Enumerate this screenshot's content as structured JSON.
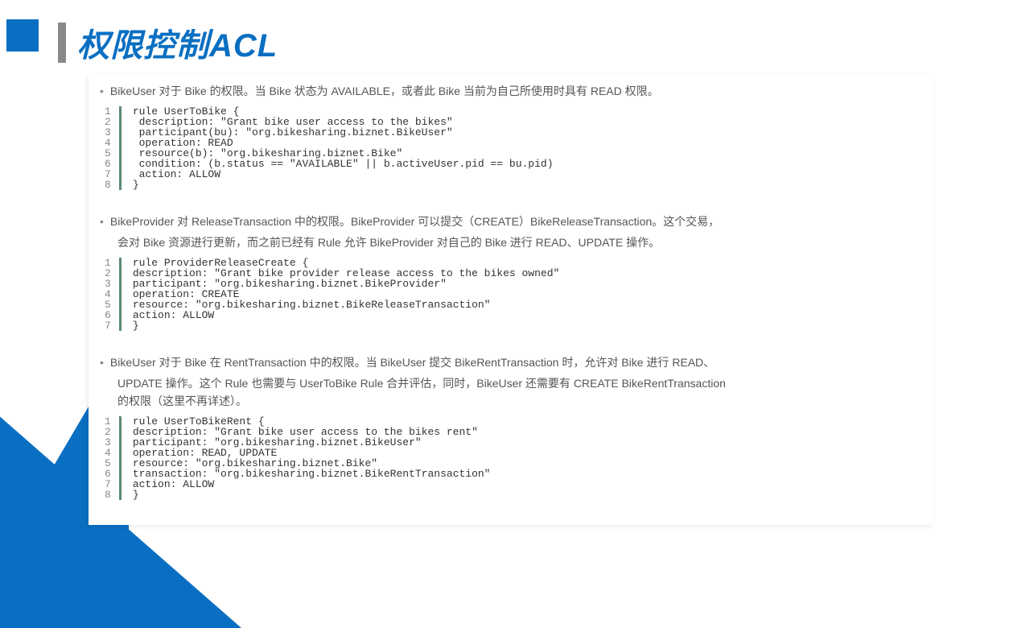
{
  "title": "权限控制ACL",
  "sections": [
    {
      "bullet": "BikeUser 对于 Bike 的权限。当 Bike 状态为 AVAILABLE，或者此 Bike 当前为自己所使用时具有 READ 权限。",
      "code": [
        "rule UserToBike {",
        " description: \"Grant bike user access to the bikes\"",
        " participant(bu): \"org.bikesharing.biznet.BikeUser\"",
        " operation: READ",
        " resource(b): \"org.bikesharing.biznet.Bike\"",
        " condition: (b.status == \"AVAILABLE\" || b.activeUser.pid == bu.pid)",
        " action: ALLOW",
        "}"
      ]
    },
    {
      "bullet": "BikeProvider 对 ReleaseTransaction 中的权限。BikeProvider 可以提交（CREATE）BikeReleaseTransaction。这个交易，",
      "bullet_cont": "会对 Bike 资源进行更新，而之前已经有 Rule 允许 BikeProvider 对自己的 Bike 进行 READ、UPDATE 操作。",
      "code": [
        "rule ProviderReleaseCreate {",
        "description: \"Grant bike provider release access to the bikes owned\"",
        "participant: \"org.bikesharing.biznet.BikeProvider\"",
        "operation: CREATE",
        "resource: \"org.bikesharing.biznet.BikeReleaseTransaction\"",
        "action: ALLOW",
        "}"
      ]
    },
    {
      "bullet": "BikeUser 对于 Bike 在 RentTransaction 中的权限。当 BikeUser 提交 BikeRentTransaction 时，允许对 Bike 进行 READ、",
      "bullet_cont": "UPDATE 操作。这个 Rule 也需要与 UserToBike Rule 合并评估，同时，BikeUser 还需要有 CREATE BikeRentTransaction",
      "bullet_cont2": "的权限（这里不再详述）。",
      "code": [
        "rule UserToBikeRent {",
        "description: \"Grant bike user access to the bikes rent\"",
        "participant: \"org.bikesharing.biznet.BikeUser\"",
        "operation: READ, UPDATE",
        "resource: \"org.bikesharing.biznet.Bike\"",
        "transaction: \"org.bikesharing.biznet.BikeRentTransaction\"",
        "action: ALLOW",
        "}"
      ]
    }
  ]
}
